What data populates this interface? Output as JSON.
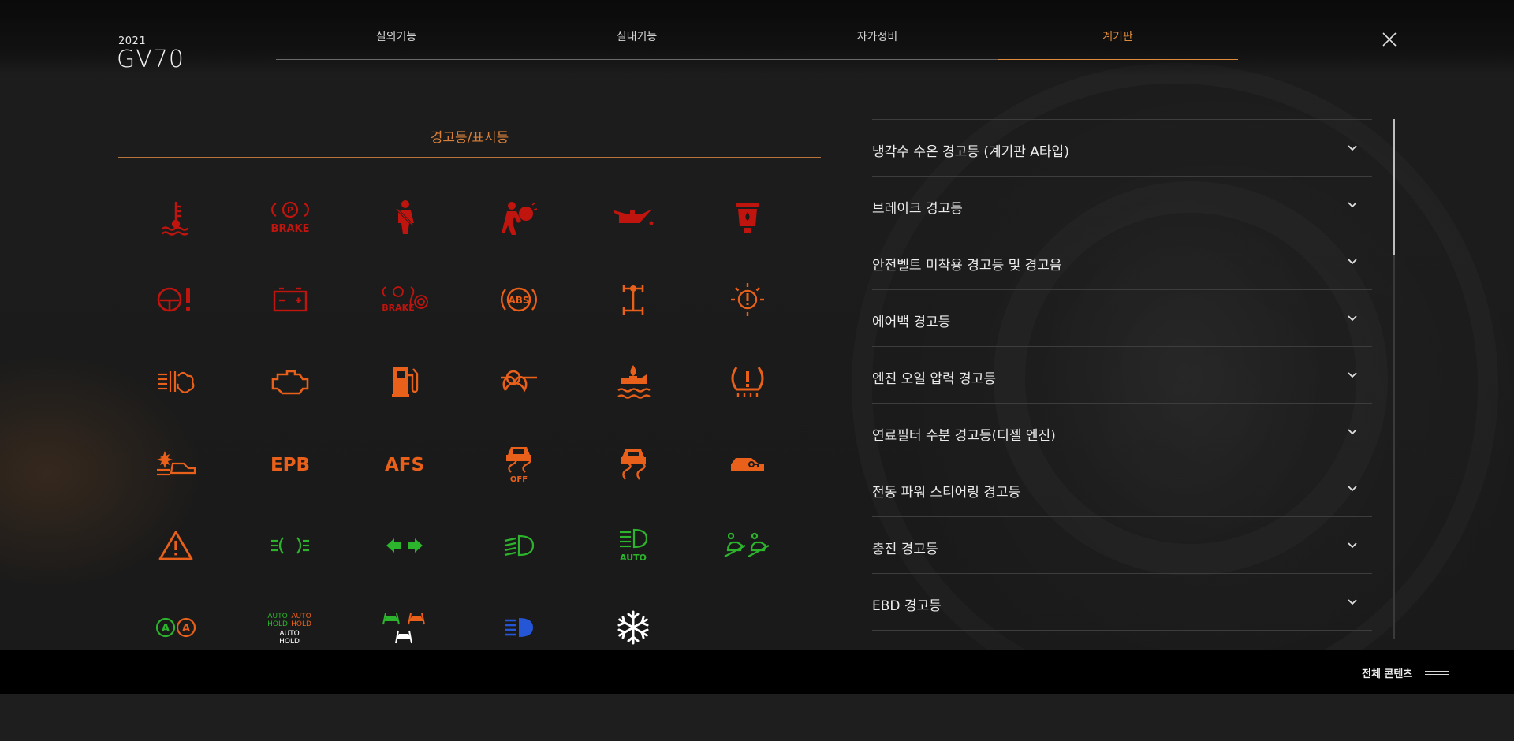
{
  "brand": {
    "year": "2021",
    "model": "GV70"
  },
  "nav": {
    "tabs": [
      {
        "label": "실외기능"
      },
      {
        "label": "실내기능"
      },
      {
        "label": "자가정비"
      },
      {
        "label": "계기판",
        "active": true
      }
    ]
  },
  "section": {
    "title": "경고등/표시등"
  },
  "icons": [
    {
      "name": "coolant-temperature-warning-icon",
      "color": "#c0140e"
    },
    {
      "name": "brake-warning-icon",
      "color": "#c0140e"
    },
    {
      "name": "seatbelt-warning-icon",
      "color": "#c0140e"
    },
    {
      "name": "airbag-warning-icon",
      "color": "#c0140e"
    },
    {
      "name": "engine-oil-pressure-icon",
      "color": "#c0140e"
    },
    {
      "name": "fuel-filter-water-icon",
      "color": "#c0140e"
    },
    {
      "name": "power-steering-warning-icon",
      "color": "#c0140e"
    },
    {
      "name": "charging-warning-icon",
      "color": "#c0140e"
    },
    {
      "name": "ebd-warning-icon",
      "color": "#c0140e"
    },
    {
      "name": "abs-warning-icon",
      "color": "#e8601a"
    },
    {
      "name": "awd-warning-icon",
      "color": "#e8601a"
    },
    {
      "name": "lamp-failure-icon",
      "color": "#e8601a"
    },
    {
      "name": "glow-plug-icon",
      "color": "#e8601a"
    },
    {
      "name": "check-engine-icon",
      "color": "#e8601a"
    },
    {
      "name": "low-fuel-icon",
      "color": "#e8601a"
    },
    {
      "name": "diesel-preheat-icon",
      "color": "#e8601a"
    },
    {
      "name": "low-coolant-icon",
      "color": "#e8601a"
    },
    {
      "name": "tire-pressure-icon",
      "color": "#e8601a"
    },
    {
      "name": "forward-collision-icon",
      "color": "#e8601a"
    },
    {
      "name": "epb-icon",
      "color": "#e8601a"
    },
    {
      "name": "afs-icon",
      "color": "#e8601a"
    },
    {
      "name": "esc-off-icon",
      "color": "#e8601a"
    },
    {
      "name": "esc-icon",
      "color": "#e8601a"
    },
    {
      "name": "immobilizer-icon",
      "color": "#e8601a"
    },
    {
      "name": "hazard-warning-icon",
      "color": "#e8601a"
    },
    {
      "name": "position-lamp-icon",
      "color": "#2cb52c"
    },
    {
      "name": "turn-signal-icon",
      "color": "#2cb52c"
    },
    {
      "name": "low-beam-icon",
      "color": "#2cb52c"
    },
    {
      "name": "auto-light-icon",
      "color": "#2cb52c"
    },
    {
      "name": "hill-descent-icon",
      "color": "#2cb52c"
    },
    {
      "name": "auto-stop-icon",
      "color": "#2cb52c"
    },
    {
      "name": "auto-hold-icon",
      "color": "#2cb52c"
    },
    {
      "name": "lane-keeping-icon",
      "color": "#2cb52c"
    },
    {
      "name": "high-beam-icon",
      "color": "#2456d6"
    },
    {
      "name": "icy-road-icon",
      "color": "#ffffff"
    }
  ],
  "icon_text": {
    "brake": "BRAKE",
    "brake_small": "BRAKE",
    "abs": "ABS",
    "epb": "EPB",
    "afs": "AFS",
    "off": "OFF",
    "auto": "AUTO",
    "auto_hold": "AUTO",
    "hold": "HOLD",
    "a": "A"
  },
  "accordion": {
    "items": [
      {
        "label": "냉각수 수온 경고등 (계기판 A타입)"
      },
      {
        "label": "브레이크 경고등"
      },
      {
        "label": "안전벨트 미착용 경고등 및 경고음"
      },
      {
        "label": "에어백 경고등"
      },
      {
        "label": "엔진 오일 압력 경고등"
      },
      {
        "label": "연료필터 수분 경고등(디젤 엔진)"
      },
      {
        "label": "전동 파워 스티어링 경고등"
      },
      {
        "label": "충전 경고등"
      },
      {
        "label": "EBD 경고등"
      }
    ]
  },
  "scrollbar": {
    "position": 0
  },
  "footer": {
    "all_contents": "전체 콘텐츠"
  },
  "colors": {
    "accent": "#e08a3c",
    "red": "#c0140e",
    "orange": "#e8601a",
    "green": "#2cb52c",
    "blue": "#2456d6"
  }
}
